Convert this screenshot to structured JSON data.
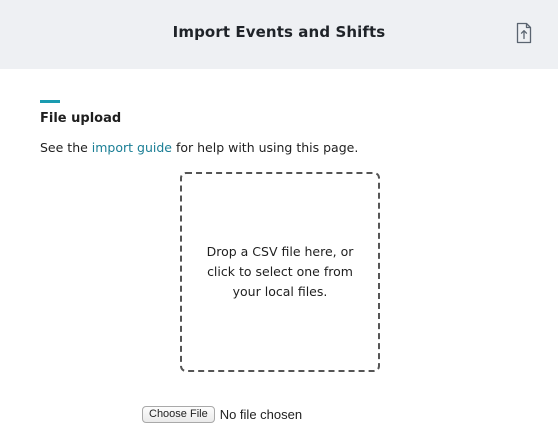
{
  "header": {
    "title": "Import Events and Shifts",
    "icon": "file-upload-icon"
  },
  "section": {
    "title": "File upload",
    "help_prefix": "See the ",
    "help_link": "import guide",
    "help_suffix": " for help with using this page."
  },
  "dropzone": {
    "text": "Drop a CSV file here, or click to select one from your local files."
  },
  "file_input": {
    "button_label": "Choose File",
    "status": "No file chosen"
  },
  "colors": {
    "accent": "#1a9bb0",
    "link": "#1a7e95",
    "header_bg": "#eef0f3"
  }
}
